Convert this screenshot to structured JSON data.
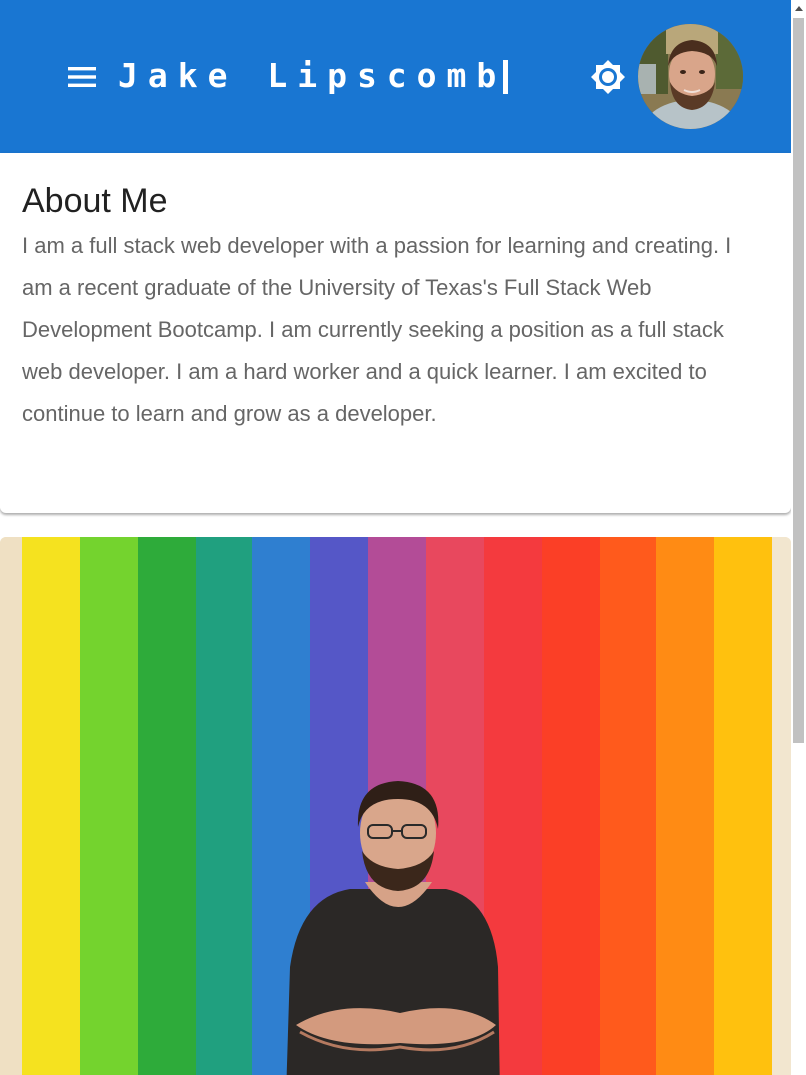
{
  "header": {
    "title": "Jake Lipscomb",
    "background_color": "#1976d2",
    "menu_icon": "hamburger-menu-icon",
    "theme_icon": "brightness-icon",
    "avatar_icon": "profile-photo"
  },
  "about": {
    "heading": "About Me",
    "body": "I am a full stack web developer with a passion for learning and creating. I am a recent graduate of the University of Texas's Full Stack Web Development Bootcamp. I am currently seeking a position as a full stack web developer. I am a hard worker and a quick learner. I am excited to continue to learn and grow as a developer."
  },
  "photo": {
    "subject": "portrait-photo-rainbow-wall"
  }
}
